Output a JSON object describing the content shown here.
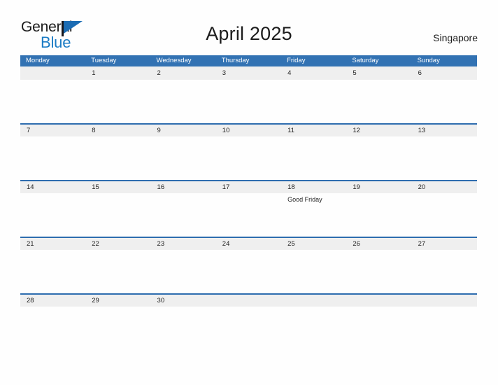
{
  "brand": {
    "name_part1": "General",
    "name_part2": "Blue",
    "flag_color": "#1B6CB3",
    "blue_text_color": "#1B7BC4"
  },
  "header": {
    "title": "April 2025",
    "locale": "Singapore"
  },
  "theme": {
    "header_blue": "#3272B3",
    "row_band_gray": "#EFEFEF",
    "row_border_blue": "#2E6DAF",
    "page_background": "#FEFEFE",
    "text_color": "#1F1F1F"
  },
  "calendar": {
    "month": "April",
    "year": "2025",
    "weekday_headers": [
      "Monday",
      "Tuesday",
      "Wednesday",
      "Thursday",
      "Friday",
      "Saturday",
      "Sunday"
    ],
    "weeks": [
      {
        "days": [
          {
            "number": "",
            "events": []
          },
          {
            "number": "1",
            "events": []
          },
          {
            "number": "2",
            "events": []
          },
          {
            "number": "3",
            "events": []
          },
          {
            "number": "4",
            "events": []
          },
          {
            "number": "5",
            "events": []
          },
          {
            "number": "6",
            "events": []
          }
        ]
      },
      {
        "days": [
          {
            "number": "7",
            "events": []
          },
          {
            "number": "8",
            "events": []
          },
          {
            "number": "9",
            "events": []
          },
          {
            "number": "10",
            "events": []
          },
          {
            "number": "11",
            "events": []
          },
          {
            "number": "12",
            "events": []
          },
          {
            "number": "13",
            "events": []
          }
        ]
      },
      {
        "days": [
          {
            "number": "14",
            "events": []
          },
          {
            "number": "15",
            "events": []
          },
          {
            "number": "16",
            "events": []
          },
          {
            "number": "17",
            "events": []
          },
          {
            "number": "18",
            "events": [
              "Good Friday"
            ]
          },
          {
            "number": "19",
            "events": []
          },
          {
            "number": "20",
            "events": []
          }
        ]
      },
      {
        "days": [
          {
            "number": "21",
            "events": []
          },
          {
            "number": "22",
            "events": []
          },
          {
            "number": "23",
            "events": []
          },
          {
            "number": "24",
            "events": []
          },
          {
            "number": "25",
            "events": []
          },
          {
            "number": "26",
            "events": []
          },
          {
            "number": "27",
            "events": []
          }
        ]
      },
      {
        "days": [
          {
            "number": "28",
            "events": []
          },
          {
            "number": "29",
            "events": []
          },
          {
            "number": "30",
            "events": []
          },
          {
            "number": "",
            "events": []
          },
          {
            "number": "",
            "events": []
          },
          {
            "number": "",
            "events": []
          },
          {
            "number": "",
            "events": []
          }
        ]
      }
    ]
  }
}
